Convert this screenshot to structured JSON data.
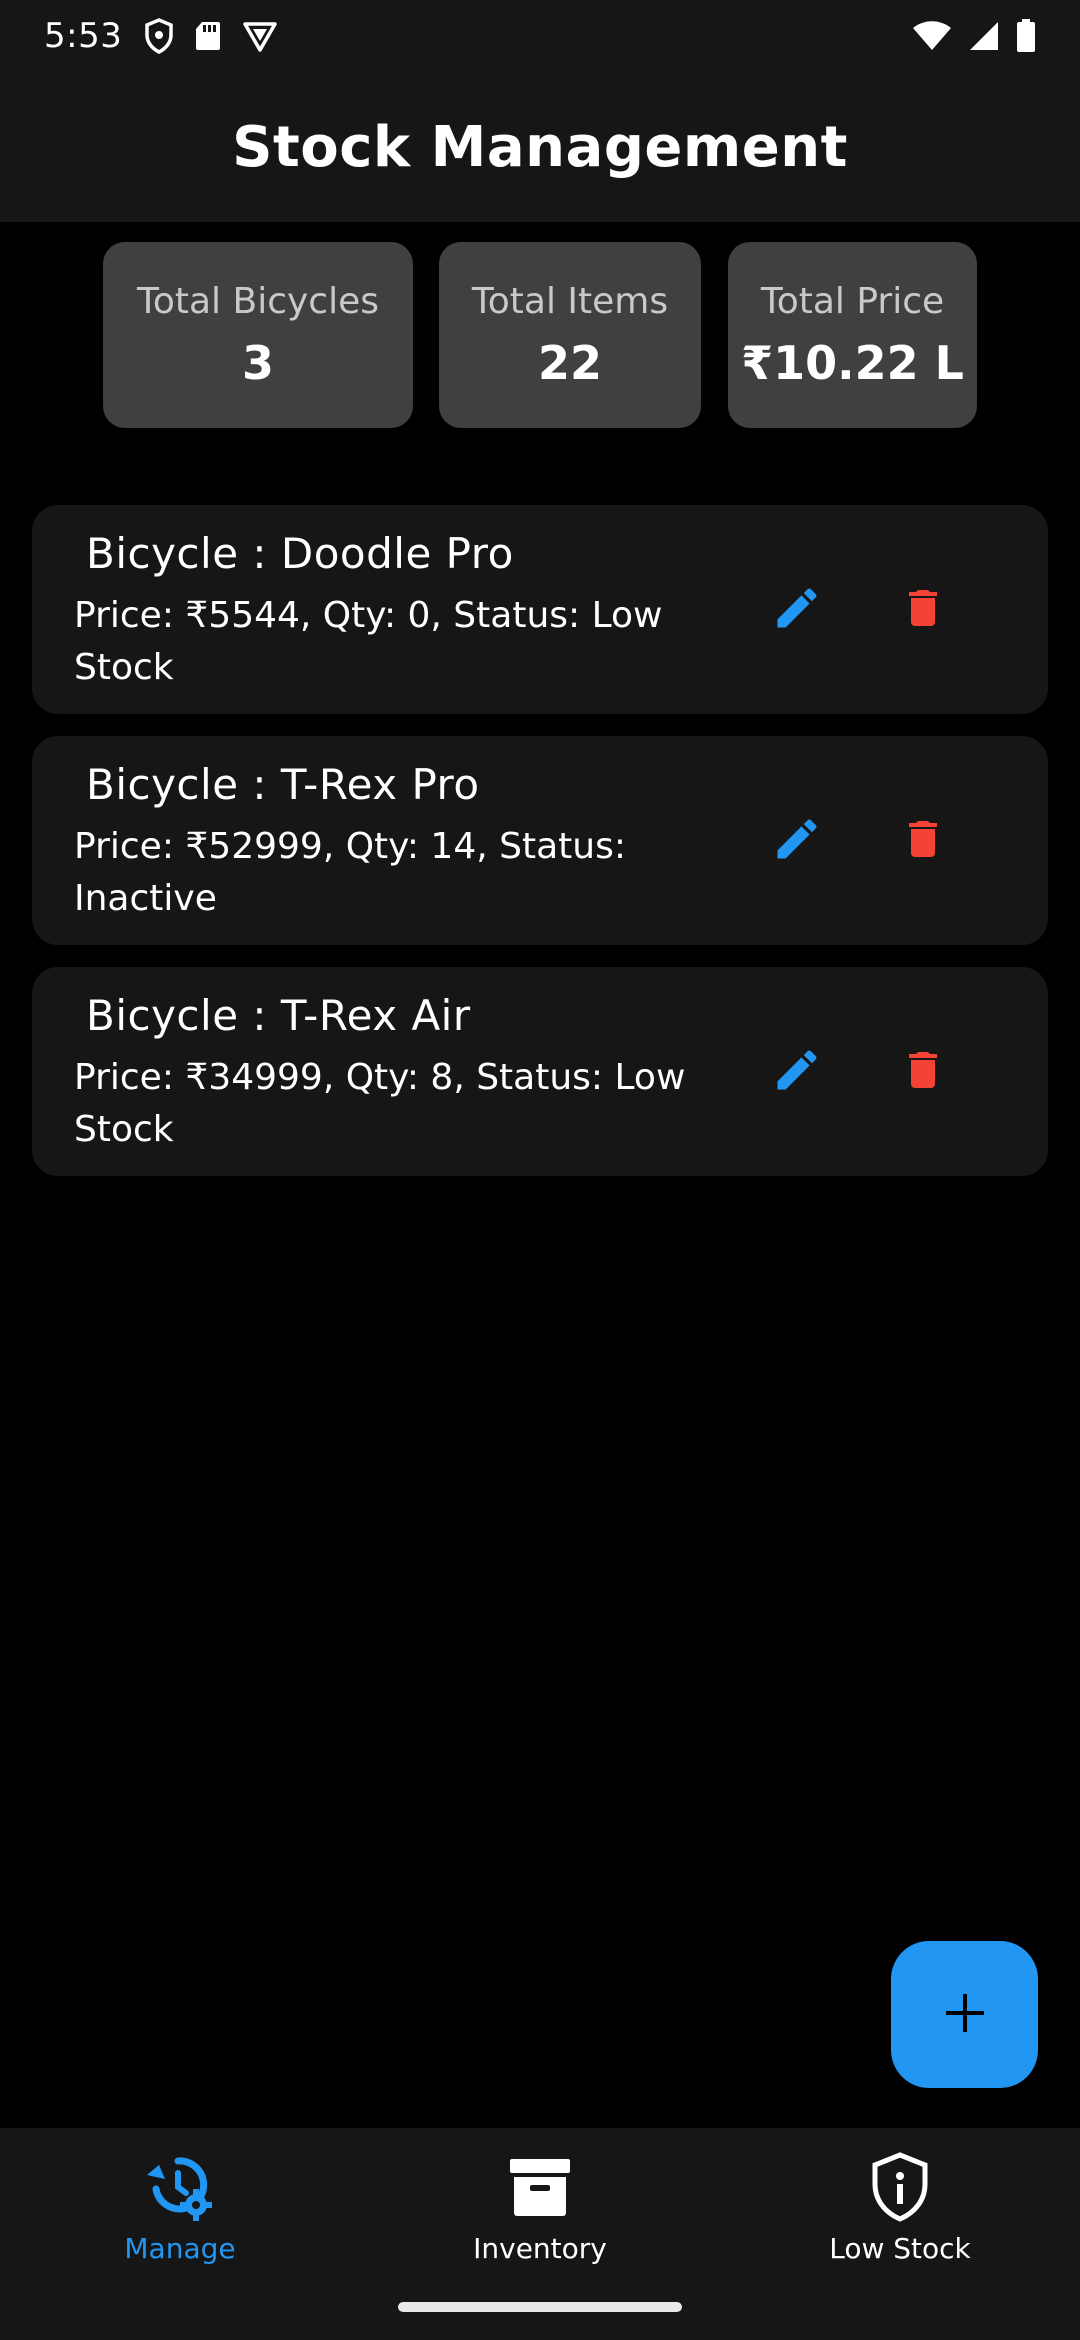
{
  "status_bar": {
    "time": "5:53",
    "left_icons": [
      "shield-icon",
      "sd-card-icon",
      "vpn-badge-icon"
    ],
    "right_icons": [
      "wifi-icon",
      "cell-signal-icon",
      "battery-icon"
    ]
  },
  "app_bar": {
    "title": "Stock Management"
  },
  "summary": [
    {
      "label": "Total Bicycles",
      "value": "3"
    },
    {
      "label": "Total Items",
      "value": "22"
    },
    {
      "label": "Total Price",
      "value": "₹10.22 L"
    }
  ],
  "stock_items": [
    {
      "title": "Bicycle : Doodle Pro",
      "details": "Price: ₹5544, Qty: 0, Status: Low Stock"
    },
    {
      "title": "Bicycle : T-Rex Pro",
      "details": "Price: ₹52999, Qty: 14, Status: Inactive"
    },
    {
      "title": "Bicycle : T-Rex Air",
      "details": "Price: ₹34999, Qty: 8, Status: Low Stock"
    }
  ],
  "actions": {
    "edit_icon": "pencil-icon",
    "delete_icon": "trash-icon",
    "fab_icon": "plus-icon"
  },
  "bottom_nav": {
    "items": [
      {
        "label": "Manage",
        "icon": "history-gear-icon",
        "active": true
      },
      {
        "label": "Inventory",
        "icon": "archive-box-icon",
        "active": false
      },
      {
        "label": "Low Stock",
        "icon": "shield-info-icon",
        "active": false
      }
    ]
  },
  "colors": {
    "accent": "#2196f3",
    "delete": "#f44336",
    "card": "#404040",
    "surface": "#161616",
    "background": "#000000"
  }
}
